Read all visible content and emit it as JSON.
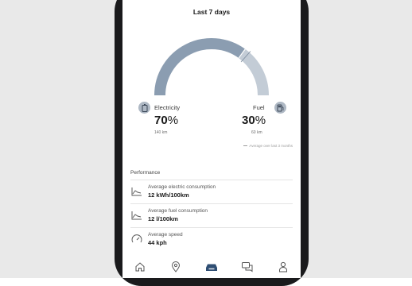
{
  "header": {
    "title": "Last 7 days"
  },
  "gauge": {
    "electricity_fraction": 0.7,
    "electric_color": "#8b9db1",
    "fuel_color": "#c3ccd6"
  },
  "electricity": {
    "label": "Electricity",
    "percent": "70",
    "unit": "%",
    "distance": "140 km"
  },
  "fuel": {
    "label": "Fuel",
    "percent": "30",
    "unit": "%",
    "distance": "60 km"
  },
  "legend": {
    "text": "Average over last 3 months"
  },
  "performance": {
    "title": "Performance",
    "items": [
      {
        "label": "Average electric consumption",
        "value": "12 kWh/100km",
        "icon": "chart-icon"
      },
      {
        "label": "Average fuel consumption",
        "value": "12 l/100km",
        "icon": "chart-icon"
      },
      {
        "label": "Average speed",
        "value": "44 kph",
        "icon": "speedometer-icon"
      }
    ]
  },
  "nav": {
    "items": [
      {
        "name": "home",
        "icon": "home-icon"
      },
      {
        "name": "map",
        "icon": "location-pin-icon"
      },
      {
        "name": "car",
        "icon": "car-icon",
        "active": true
      },
      {
        "name": "chat",
        "icon": "chat-icon"
      },
      {
        "name": "profile",
        "icon": "person-icon"
      }
    ]
  }
}
